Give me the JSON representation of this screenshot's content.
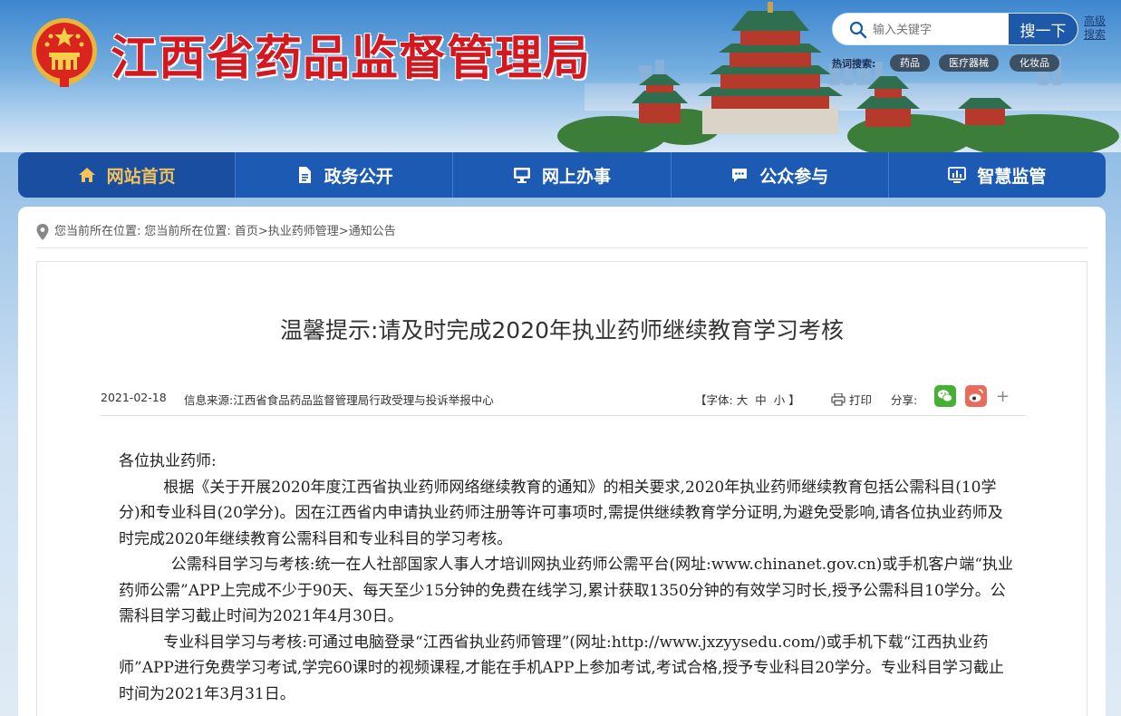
{
  "header": {
    "site_title": "江西省药品监督管理局",
    "search": {
      "placeholder": "输入关键字",
      "button": "搜一下",
      "advanced": "高级搜索"
    },
    "hot_label": "热词搜索:",
    "hot_tags": [
      "药品",
      "医疗器械",
      "化妆品"
    ]
  },
  "nav": [
    {
      "label": "网站首页",
      "icon": "home-icon",
      "active": true
    },
    {
      "label": "政务公开",
      "icon": "document-icon"
    },
    {
      "label": "网上办事",
      "icon": "monitor-icon"
    },
    {
      "label": "公众参与",
      "icon": "chat-icon"
    },
    {
      "label": "智慧监管",
      "icon": "chart-screen-icon"
    }
  ],
  "breadcrumb": {
    "prefix": "您当前所在位置:",
    "text": "您当前所在位置: 首页>执业药师管理>通知公告"
  },
  "article": {
    "title": "温馨提示:请及时完成2020年执业药师继续教育学习考核",
    "date": "2021-02-18",
    "source": "信息来源:江西省食品药品监督管理局行政受理与投诉举报中心",
    "font_label": "【字体:",
    "font_sizes": [
      "大",
      "中",
      "小"
    ],
    "font_end": "】",
    "print": "打印",
    "share": "分享:",
    "share_more": "+",
    "paragraphs": [
      "各位执业药师:",
      "根据《关于开展2020年度江西省执业药师网络继续教育的通知》的相关要求,2020年执业药师继续教育包括公需科目(10学分)和专业科目(20学分)。因在江西省内申请执业药师注册等许可事项时,需提供继续教育学分证明,为避免受影响,请各位执业药师及时完成2020年继续教育公需科目和专业科目的学习考核。",
      "公需科目学习与考核:统一在人社部国家人事人才培训网执业药师公需平台(网址:www.chinanet.gov.cn)或手机客户端“执业药师公需”APP上完成不少于90天、每天至少15分钟的免费在线学习,累计获取1350分钟的有效学习时长,授予公需科目10学分。公需科目学习截止时间为2021年4月30日。",
      "专业科目学习与考核:可通过电脑登录“江西省执业药师管理”(网址:http://www.jxzyysedu.com/)或手机下载“江西执业药师”APP进行免费学习考试,学完60课时的视频课程,才能在手机APP上参加考试,考试合格,授予专业科目20学分。专业科目学习截止时间为2021年3月31日。"
    ]
  },
  "colors": {
    "title_red": "#d3191f",
    "nav_blue": "#1c5ab3",
    "nav_active_text": "#f4c25a",
    "wechat_green": "#46b035",
    "weibo_red": "#e86b5b"
  }
}
